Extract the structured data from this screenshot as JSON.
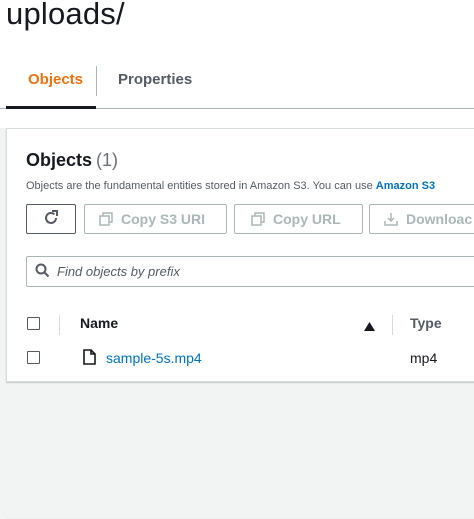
{
  "page": {
    "title": "uploads/"
  },
  "tabs": [
    {
      "label": "Objects",
      "active": true
    },
    {
      "label": "Properties",
      "active": false
    }
  ],
  "objects_panel": {
    "title": "Objects",
    "count": "(1)",
    "description": "Objects are the fundamental entities stored in Amazon S3. You can use ",
    "description_link": "Amazon S3",
    "toolbar": {
      "refresh_icon": "refresh-icon",
      "copy_s3_uri": "Copy S3 URI",
      "copy_url": "Copy URL",
      "download": "Downloac"
    },
    "search": {
      "placeholder": "Find objects by prefix",
      "value": ""
    },
    "table": {
      "columns": [
        "Name",
        "Type"
      ],
      "sort_icon": "sort-ascending-icon",
      "rows": [
        {
          "name": "sample-5s.mp4",
          "type": "mp4",
          "icon": "file-icon"
        }
      ]
    }
  },
  "colors": {
    "accent_orange": "#ec7211",
    "link_blue": "#0073bb",
    "text_dark": "#16191f",
    "disabled_gray": "#aab7b8"
  }
}
